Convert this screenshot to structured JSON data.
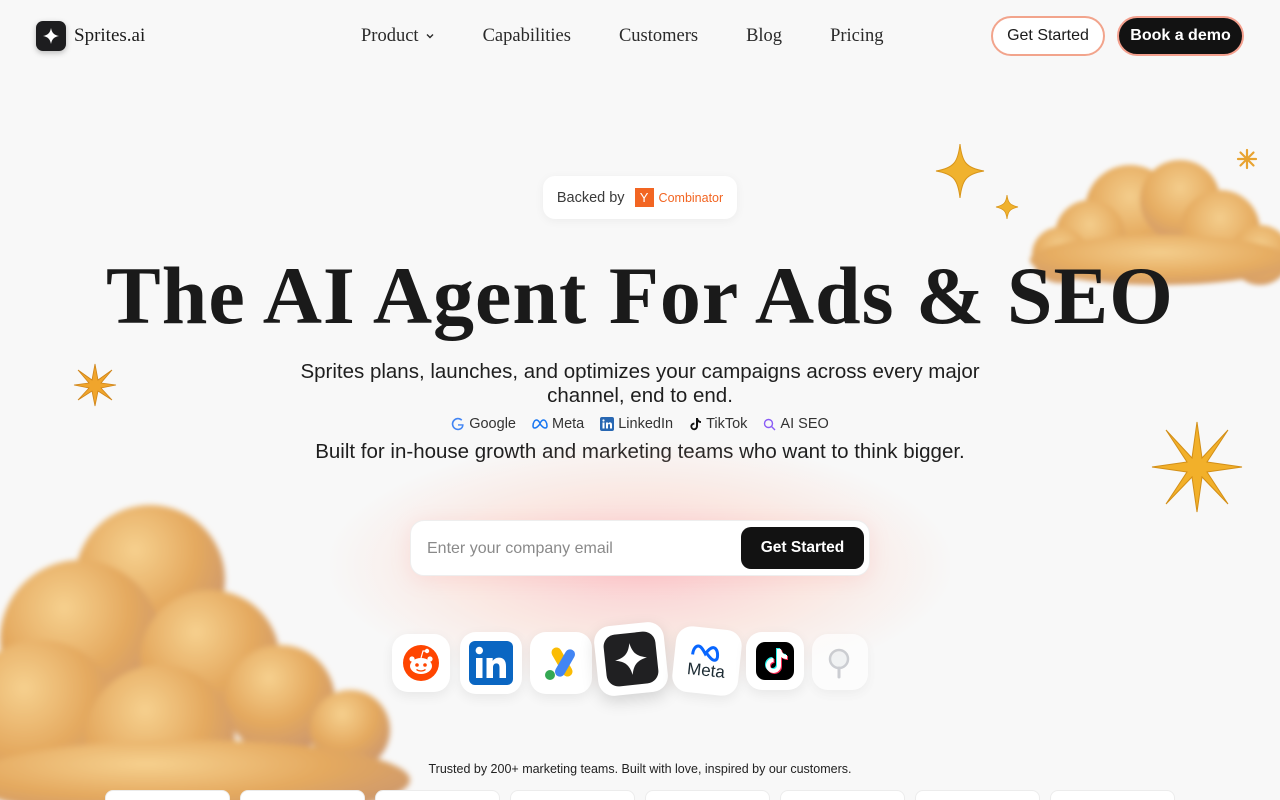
{
  "brand": {
    "name": "Sprites.ai",
    "logo_icon": "sparkle-icon"
  },
  "nav": {
    "links": [
      {
        "label": "Product",
        "has_dropdown": true
      },
      {
        "label": "Capabilities"
      },
      {
        "label": "Customers"
      },
      {
        "label": "Blog"
      },
      {
        "label": "Pricing"
      }
    ],
    "get_started": "Get Started",
    "book_demo": "Book a demo"
  },
  "badge": {
    "prefix": "Backed by",
    "yc_letter": "Y",
    "yc_name": "Combinator"
  },
  "hero": {
    "headline": "The AI Agent For Ads & SEO",
    "subtitle": "Sprites plans, launches, and optimizes your campaigns across every major channel, end to end.",
    "channels": [
      {
        "label": "Google",
        "icon": "google-icon"
      },
      {
        "label": "Meta",
        "icon": "meta-icon"
      },
      {
        "label": "LinkedIn",
        "icon": "linkedin-icon"
      },
      {
        "label": "TikTok",
        "icon": "tiktok-icon"
      },
      {
        "label": "AI SEO",
        "icon": "search-icon"
      }
    ],
    "tagline": "Built for in-house growth and marketing teams who want to think bigger."
  },
  "signup": {
    "placeholder": "Enter your company email",
    "value": "",
    "button": "Get Started"
  },
  "app_icons": [
    "reddit-icon",
    "linkedin-icon",
    "google-ads-icon",
    "sprites-icon",
    "meta-icon",
    "tiktok-icon",
    "search-magnifier-icon"
  ],
  "app_labels": {
    "meta": "Meta"
  },
  "trusted": "Trusted by 200+ marketing teams. Built with love, inspired by our customers.",
  "colors": {
    "accent_border": "#f2a48c",
    "yc_orange": "#f26522",
    "dark": "#121212",
    "cloud": "#e8b46a",
    "star": "#f0b22e"
  }
}
